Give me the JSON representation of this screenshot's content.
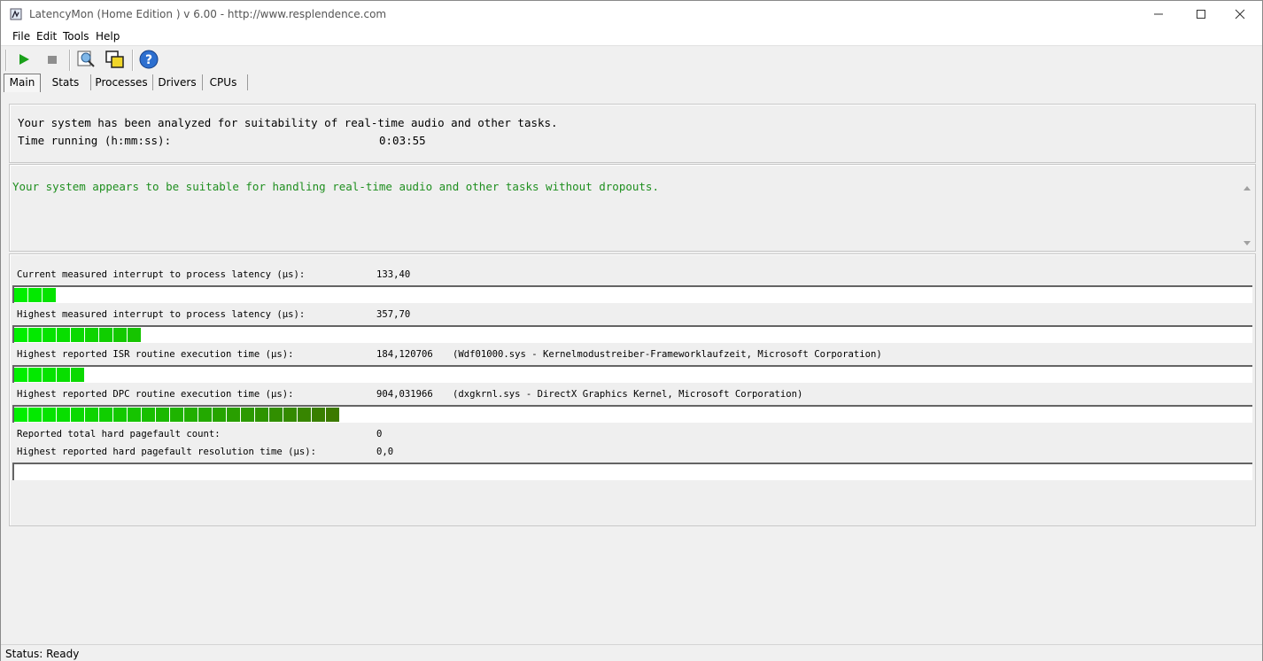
{
  "window": {
    "title": "LatencyMon  (Home Edition )  v 6.00 - http://www.resplendence.com"
  },
  "menu": [
    "File",
    "Edit",
    "Tools",
    "Help"
  ],
  "toolbar": {
    "icons": [
      "start-icon",
      "stop-icon",
      "report-icon",
      "windows-icon",
      "help-icon"
    ]
  },
  "tabs": [
    "Main",
    "Stats",
    "Processes",
    "Drivers",
    "CPUs"
  ],
  "summary": {
    "line1": "Your system has been analyzed for suitability of real-time audio and other tasks.",
    "time_label": "Time running (h:mm:ss):",
    "time_value": "0:03:55"
  },
  "verdict": "Your system appears to be suitable for handling real-time audio and other tasks without dropouts.",
  "metrics": [
    {
      "label": "Current measured interrupt to process latency (µs):",
      "value": "133,40",
      "detail": "",
      "level": 0.03
    },
    {
      "label": "Highest measured interrupt to process latency (µs):",
      "value": "357,70",
      "detail": "",
      "level": 0.1
    },
    {
      "label": "Highest reported ISR routine execution time (µs):",
      "value": "184,120706",
      "detail": "(Wdf01000.sys - Kernelmodustreiber-Frameworklaufzeit, Microsoft Corporation)",
      "level": 0.055
    },
    {
      "label": "Highest reported DPC routine execution time (µs):",
      "value": "904,031966",
      "detail": "(dxgkrnl.sys - DirectX Graphics Kernel, Microsoft Corporation)",
      "level": 0.26
    }
  ],
  "pagefault": {
    "count_label": "Reported total hard pagefault count:",
    "count_value": "0",
    "time_label": "Highest reported hard pagefault resolution time (µs):",
    "time_value": "0,0",
    "level": 0
  },
  "status": "Status: Ready",
  "colors": {
    "verdict": "#1f8f1f",
    "meter_light": "#00ee00",
    "meter_dark": "#3c7a00"
  }
}
